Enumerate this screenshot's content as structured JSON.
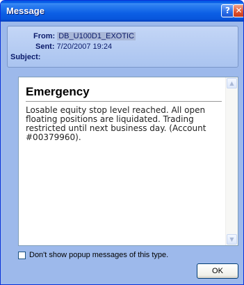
{
  "window": {
    "title": "Message",
    "help_glyph": "?",
    "close_glyph": "✕"
  },
  "header": {
    "from_label": "From:",
    "from_value": "DB_U100D1_EXOTIC",
    "sent_label": "Sent:",
    "sent_value": "7/20/2007 19:24",
    "subject_label": "Subject:",
    "subject_value": ""
  },
  "message": {
    "title": "Emergency",
    "body": "Losable equity stop level reached. All open floating positions are liquidated. Trading restricted until next business day. (Account #00379960)."
  },
  "checkbox": {
    "label": "Don't show popup messages of this type.",
    "checked": false
  },
  "buttons": {
    "ok_label": "OK"
  },
  "scrollbar": {
    "up_glyph": "▲",
    "down_glyph": "▼"
  },
  "icons": {
    "help": "help-icon",
    "close": "close-icon",
    "scroll_up": "chevron-up-icon",
    "scroll_down": "chevron-down-icon"
  },
  "colors": {
    "titlebar": "#0a5de6",
    "window_bg": "#9db9eb",
    "close_button": "#e0522e"
  }
}
